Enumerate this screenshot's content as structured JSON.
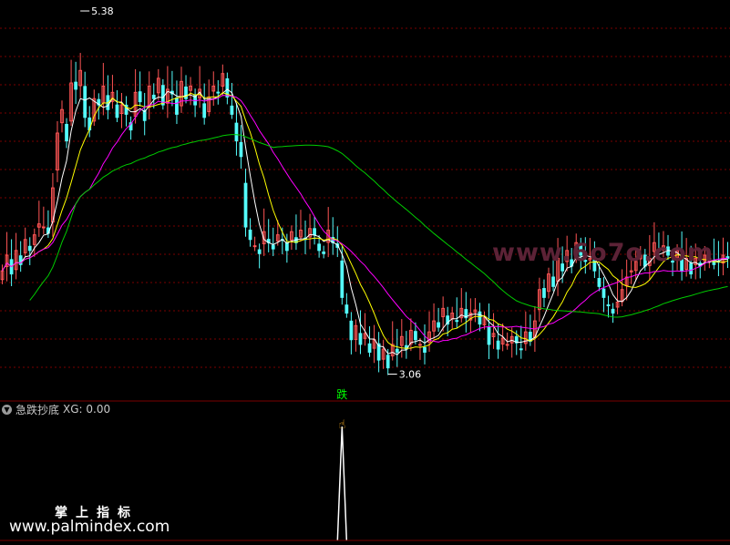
{
  "indicator": {
    "name": "急跌抄底",
    "value_text": "XG: 0.00",
    "signal_label": "跌"
  },
  "watermarks": {
    "faint": "www.6o7o.com",
    "title": "掌上指标",
    "url": "www.palmindex.com"
  },
  "colors": {
    "background": "#000000",
    "up_candle": "#ff5555",
    "down_candle": "#54fcfc",
    "grid": "#7a0000",
    "ma_white": "#ffffff",
    "ma_yellow": "#ffff00",
    "ma_magenta": "#ff00ff",
    "ma_green": "#00cc00",
    "signal_text": "#00ff00",
    "signal_line": "#ffffff"
  },
  "chart_data": [
    {
      "type": "candlestick",
      "y_range": [
        2.9,
        5.45
      ],
      "annotations": [
        {
          "text": "5.38",
          "index": 17,
          "value": 5.38
        },
        {
          "text": "3.06",
          "index": 84,
          "value": 3.06
        }
      ],
      "closes": [
        3.72,
        3.82,
        3.7,
        3.85,
        3.76,
        3.92,
        3.85,
        3.95,
        4.02,
        4.0,
        3.96,
        4.25,
        4.6,
        4.75,
        4.55,
        4.92,
        4.88,
        5.0,
        4.7,
        4.62,
        4.82,
        4.78,
        4.9,
        4.75,
        4.86,
        4.7,
        4.78,
        4.72,
        4.62,
        4.86,
        4.8,
        4.68,
        4.9,
        4.82,
        4.95,
        4.78,
        4.88,
        4.85,
        4.72,
        4.93,
        4.82,
        4.9,
        4.78,
        4.88,
        4.7,
        4.83,
        4.9,
        4.86,
        4.98,
        4.83,
        4.72,
        4.55,
        4.45,
        4.0,
        3.92,
        3.88,
        3.83,
        3.97,
        3.9,
        3.86,
        3.95,
        3.92,
        3.85,
        3.97,
        3.9,
        3.98,
        3.92,
        3.99,
        3.95,
        3.85,
        3.83,
        3.98,
        3.9,
        3.87,
        3.55,
        3.45,
        3.28,
        3.37,
        3.25,
        3.32,
        3.2,
        3.28,
        3.15,
        3.22,
        3.1,
        3.25,
        3.2,
        3.3,
        3.22,
        3.34,
        3.28,
        3.25,
        3.2,
        3.33,
        3.4,
        3.36,
        3.48,
        3.38,
        3.45,
        3.4,
        3.48,
        3.42,
        3.45,
        3.47,
        3.38,
        3.42,
        3.25,
        3.32,
        3.22,
        3.29,
        3.25,
        3.3,
        3.26,
        3.22,
        3.33,
        3.27,
        3.4,
        3.6,
        3.55,
        3.7,
        3.62,
        3.8,
        3.72,
        3.85,
        3.75,
        3.9,
        3.82,
        3.78,
        3.8,
        3.72,
        3.62,
        3.55,
        3.5,
        3.45,
        3.52,
        3.6,
        3.68,
        3.72,
        3.78,
        3.82,
        3.75,
        3.8,
        3.9,
        3.85,
        3.88,
        3.82,
        3.78,
        3.85,
        3.72,
        3.8,
        3.7,
        3.8,
        3.75,
        3.82,
        3.8,
        3.76,
        3.78,
        3.82,
        3.8
      ],
      "series": [
        {
          "name": "",
          "color": "#ffffff",
          "period": 5
        },
        {
          "name": "",
          "color": "#ffff00",
          "period": 10
        },
        {
          "name": "",
          "color": "#ff00ff",
          "period": 20
        },
        {
          "name": "",
          "color": "#00cc00",
          "period": 60
        }
      ]
    },
    {
      "type": "line",
      "series": [
        {
          "name": "XG",
          "signal_index": 74,
          "values_note": ""
        }
      ],
      "current_value": 0.0,
      "y_range": [
        0,
        1
      ]
    }
  ]
}
